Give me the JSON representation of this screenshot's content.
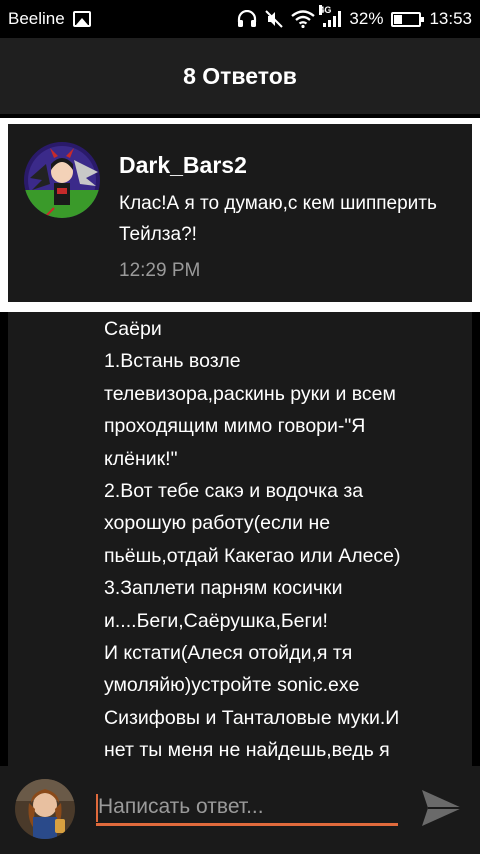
{
  "status_bar": {
    "carrier": "Beeline",
    "network": "4G",
    "battery_percent": "32%",
    "battery_level": 0.32,
    "time": "13:53"
  },
  "header": {
    "title": "8 Ответов"
  },
  "highlighted_comment": {
    "author": "Dark_Bars2",
    "text": "Клас!А я то думаю,с кем шипперить Тейлза?!",
    "time": "12:29 PM"
  },
  "post": {
    "lines": [
      "Саёри",
      "1.Встань возле",
      "телевизора,раскинь руки и всем",
      "проходящим мимо говори-\"Я",
      "клёник!\"",
      "2.Вот тебе сакэ и водочка за",
      "хорошую работу(если не",
      "пьёшь,отдай Какегао или Алесе)",
      "3.Заплети парням косички",
      "и....Беги,Саёрушка,Беги!",
      "И кстати(Алеся отойди,я тя",
      "умоляйю)устройте sonic.exe",
      "Сизифовы и Танталовые муки.И",
      "нет ты меня не найдешь,ведь я"
    ]
  },
  "reply": {
    "placeholder": "Написать ответ...",
    "value": ""
  },
  "colors": {
    "accent": "#e06a3c",
    "card_bg": "#1a1a1a",
    "header_bg": "#1f1f1f",
    "muted_text": "#9a9a9a"
  },
  "icons": {
    "status": [
      "image-icon",
      "headphones-icon",
      "mute-icon",
      "wifi-icon",
      "signal-icon",
      "battery-icon"
    ],
    "send": "send-icon"
  }
}
